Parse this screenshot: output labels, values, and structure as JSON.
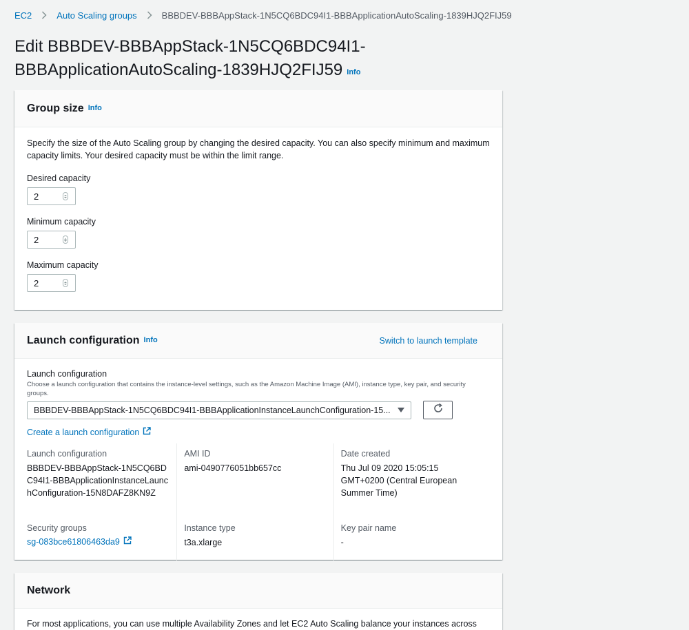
{
  "breadcrumb": {
    "items": [
      "EC2",
      "Auto Scaling groups"
    ],
    "current": "BBBDEV-BBBAppStack-1N5CQ6BDC94I1-BBBApplicationAutoScaling-1839HJQ2FIJ59"
  },
  "page": {
    "title": "Edit BBBDEV-BBBAppStack-1N5CQ6BDC94I1-BBBApplicationAutoScaling-1839HJQ2FIJ59",
    "title_line1": "Edit BBBDEV-BBBAppStack-1N5CQ6BDC94I1-",
    "title_line2": "BBBApplicationAutoScaling-1839HJQ2FIJ59",
    "info": "Info"
  },
  "group_size": {
    "title": "Group size",
    "info": "Info",
    "description": "Specify the size of the Auto Scaling group by changing the desired capacity. You can also specify minimum and maximum capacity limits. Your desired capacity must be within the limit range.",
    "desired_label": "Desired capacity",
    "desired_value": "2",
    "min_label": "Minimum capacity",
    "min_value": "2",
    "max_label": "Maximum capacity",
    "max_value": "2"
  },
  "launch_configuration": {
    "title": "Launch configuration",
    "info": "Info",
    "switch_link": "Switch to launch template",
    "field_label": "Launch configuration",
    "field_hint": "Choose a launch configuration that contains the instance-level settings, such as the Amazon Machine Image (AMI), instance type, key pair, and security groups.",
    "selected": "BBBDEV-BBBAppStack-1N5CQ6BDC94I1-BBBApplicationInstanceLaunchConfiguration-15...",
    "create_link": "Create a launch configuration",
    "details": {
      "lc_key": "Launch configuration",
      "lc_value": "BBBDEV-BBBAppStack-1N5CQ6BDC94I1-BBBApplicationInstanceLaunchConfiguration-15N8DAFZ8KN9Z",
      "ami_key": "AMI ID",
      "ami_value": "ami-0490776051bb657cc",
      "date_key": "Date created",
      "date_value": "Thu Jul 09 2020 15:05:15 GMT+0200 (Central European Summer Time)",
      "sg_key": "Security groups",
      "sg_value": "sg-083bce61806463da9",
      "type_key": "Instance type",
      "type_value": "t3a.xlarge",
      "key_pair_key": "Key pair name",
      "key_pair_value": "-"
    }
  },
  "network": {
    "title": "Network",
    "description": "For most applications, you can use multiple Availability Zones and let EC2 Auto Scaling balance your instances across"
  },
  "colors": {
    "link": "#0073bb",
    "background": "#f2f3f3",
    "text": "#16191f"
  }
}
